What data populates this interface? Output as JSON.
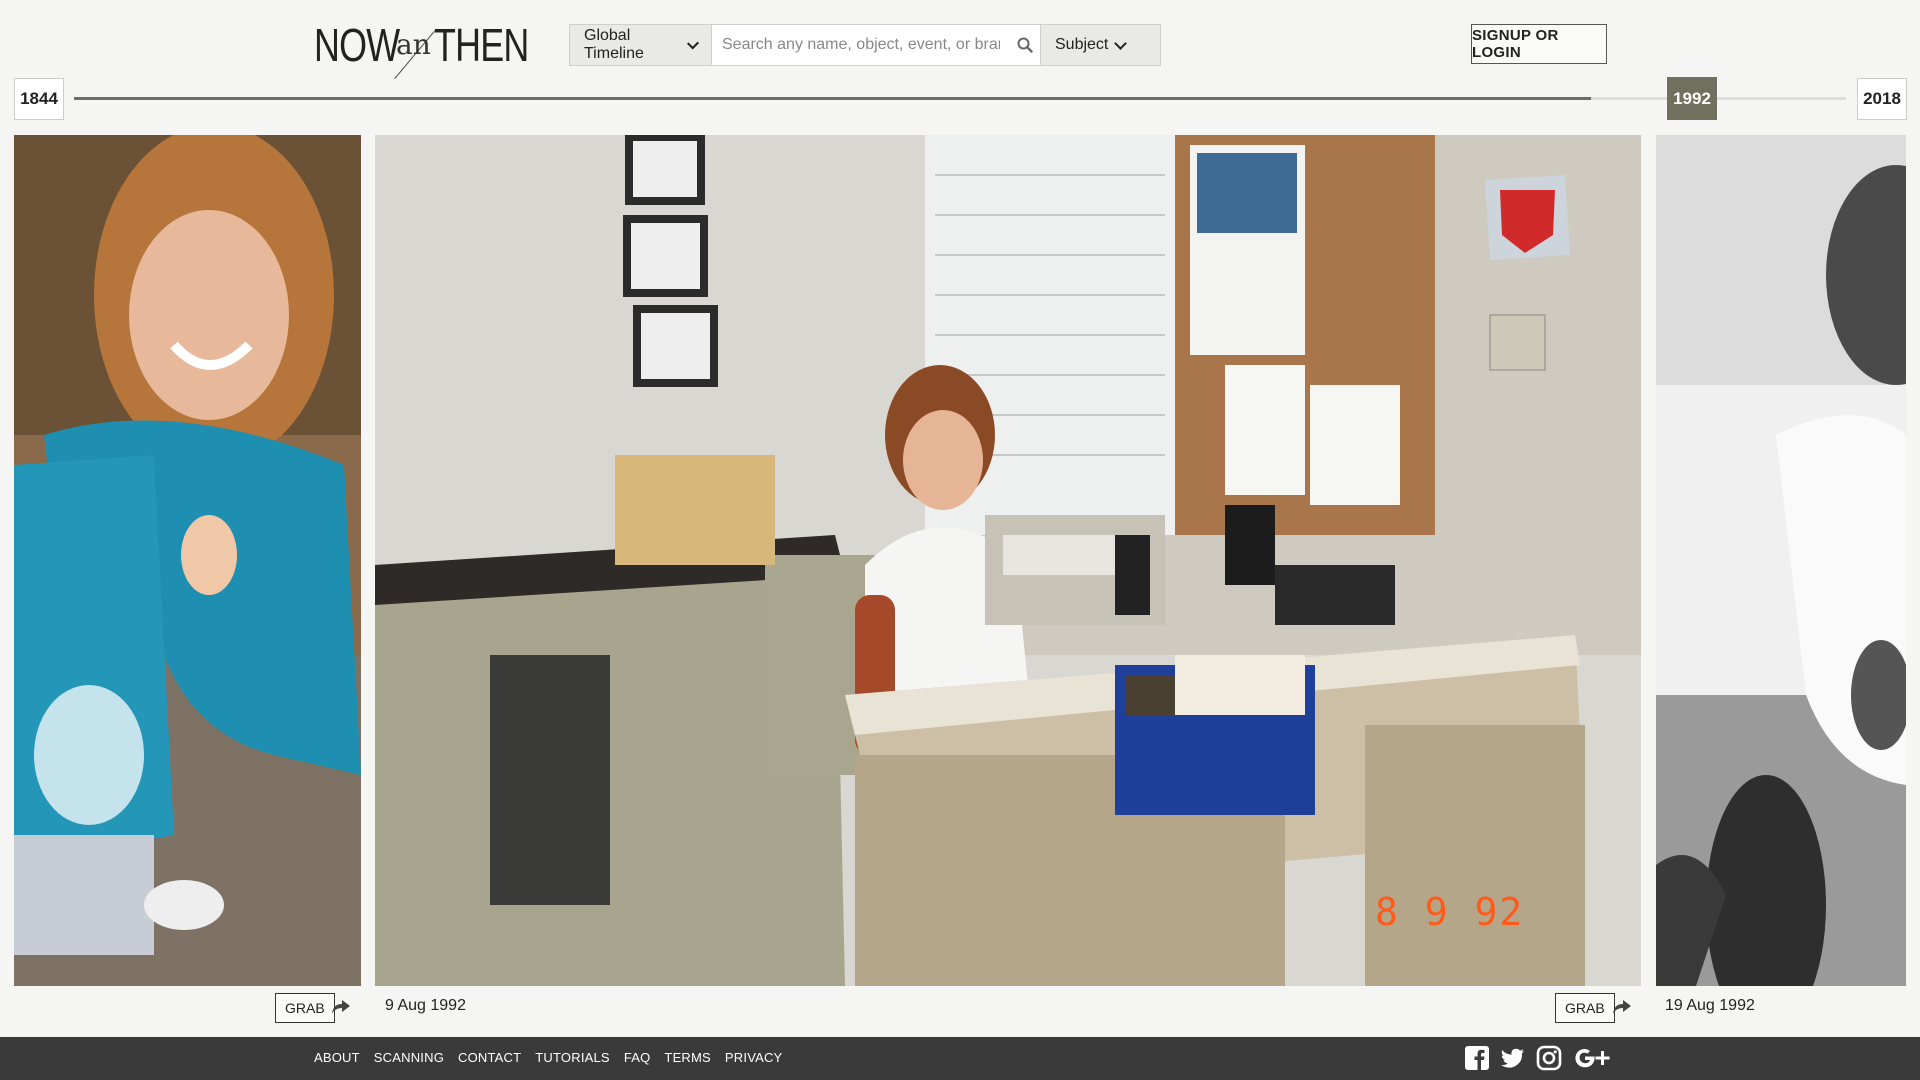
{
  "header": {
    "logo_now": "NOW",
    "logo_an": "an",
    "logo_then": "THEN",
    "timeline_dropdown": "Global Timeline",
    "search_placeholder": "Search any name, object, event, or brand",
    "subject_dropdown": "Subject",
    "signup_label": "SIGNUP OR LOGIN"
  },
  "timeline": {
    "start_year": "1844",
    "end_year": "2018",
    "current_year": "1992",
    "position_fraction": 0.856
  },
  "photos": [
    {
      "grab_label": "GRAB",
      "date": "9 Aug 1992",
      "stamp": "8  9 92"
    },
    {
      "grab_label": "GRAB",
      "date": "19 Aug 1992"
    }
  ],
  "footer": {
    "links": [
      "ABOUT",
      "SCANNING",
      "CONTACT",
      "TUTORIALS",
      "FAQ",
      "TERMS",
      "PRIVACY"
    ]
  },
  "icons": {
    "search": "search-icon",
    "share": "share-arrow-icon",
    "social": [
      "facebook-icon",
      "twitter-icon",
      "instagram-icon",
      "google-plus-icon"
    ]
  },
  "colors": {
    "accent": "#70705f",
    "footer_bg": "#3a3a3a",
    "page_bg": "#f5f5f3"
  }
}
